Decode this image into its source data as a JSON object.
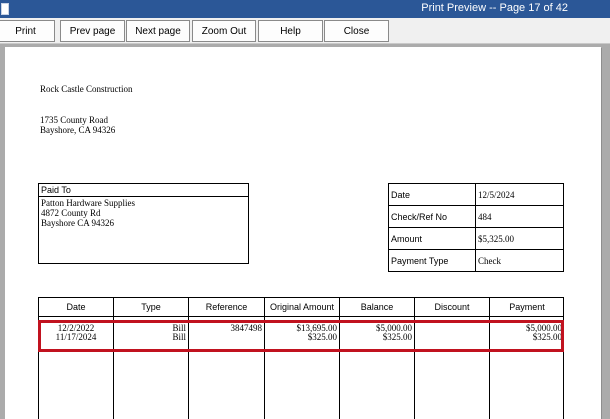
{
  "window": {
    "title": "Print Preview -- Page 17 of 42"
  },
  "toolbar": {
    "print": "Print",
    "prev_page": "Prev page",
    "next_page": "Next page",
    "zoom_out": "Zoom Out",
    "help": "Help",
    "close": "Close"
  },
  "document": {
    "company": "Rock Castle Construction",
    "address": [
      "1735 County Road",
      "Bayshore, CA 94326"
    ],
    "paid_to": {
      "label": "Paid To",
      "lines": [
        "Patton Hardware Supplies",
        "4872 County Rd",
        "Bayshore CA 94326"
      ]
    },
    "info": [
      {
        "label": "Date",
        "value": "12/5/2024"
      },
      {
        "label": "Check/Ref No",
        "value": "484"
      },
      {
        "label": "Amount",
        "value": "$5,325.00"
      },
      {
        "label": "Payment Type",
        "value": "Check"
      }
    ],
    "bills": {
      "headers": [
        "Date",
        "Type",
        "Reference",
        "Original Amount",
        "Balance",
        "Discount",
        "Payment"
      ],
      "rows": [
        {
          "date": "12/2/2022",
          "type": "Bill",
          "reference": "3847498",
          "original": "$13,695.00",
          "balance": "$5,000.00",
          "discount": "",
          "payment": "$5,000.00"
        },
        {
          "date": "11/17/2024",
          "type": "Bill",
          "reference": "",
          "original": "$325.00",
          "balance": "$325.00",
          "discount": "",
          "payment": "$325.00"
        }
      ]
    }
  },
  "colors": {
    "titlebar": "#2b5797",
    "highlight": "#c1121f"
  }
}
